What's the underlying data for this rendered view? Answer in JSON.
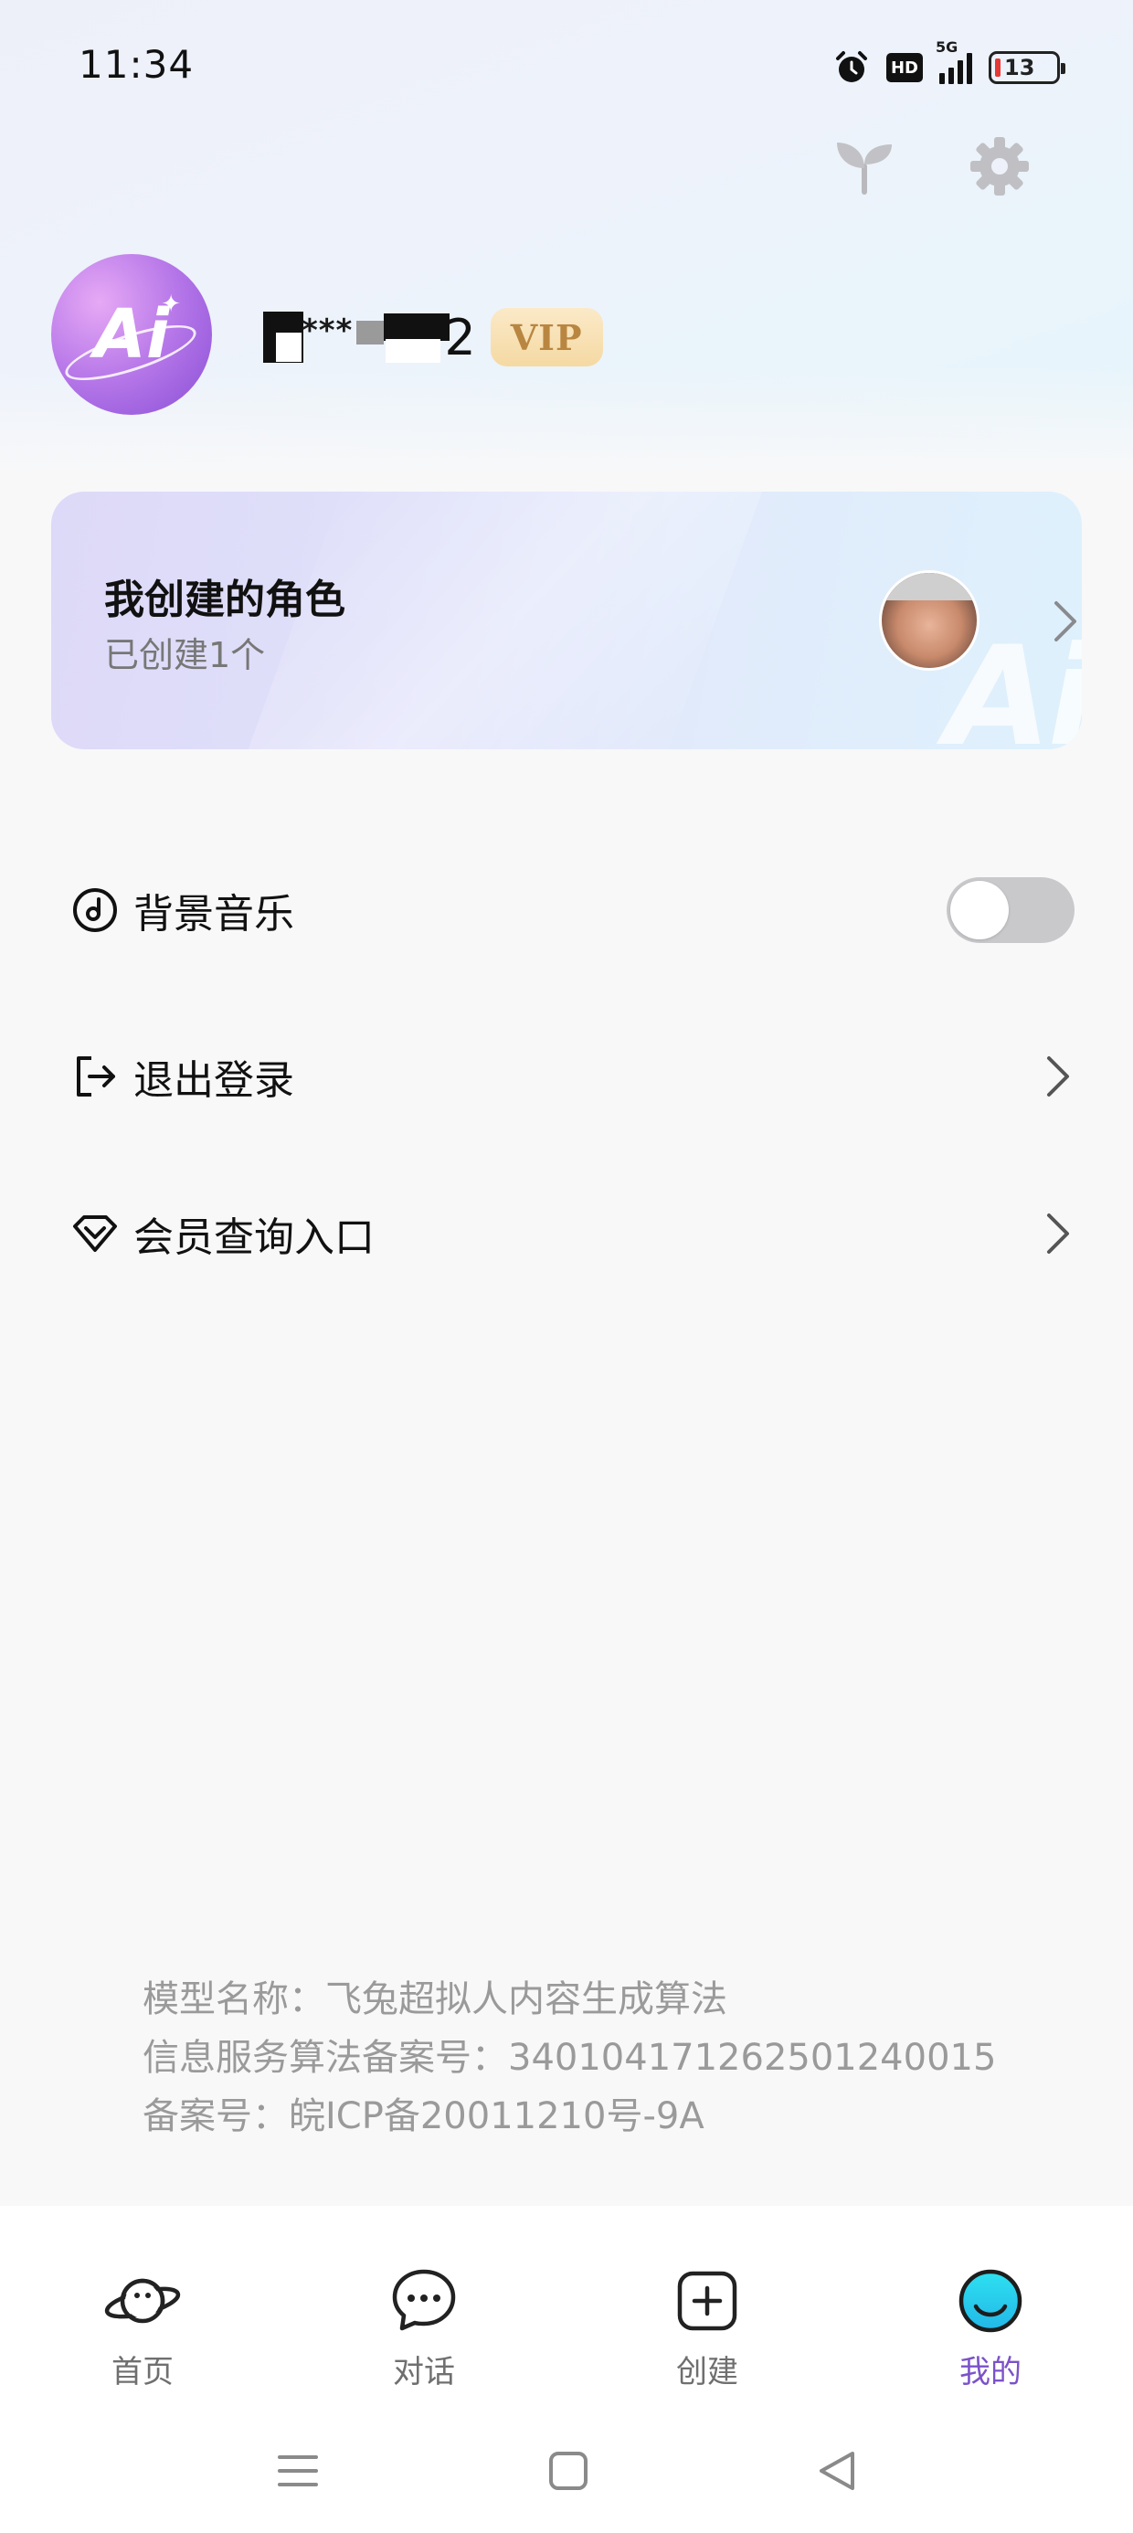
{
  "status_bar": {
    "time": "11:34",
    "hd_label": "HD",
    "network_label": "5G",
    "battery_level": "13"
  },
  "header": {
    "avatar_text": "Ai",
    "username": "2",
    "vip_label": "VIP"
  },
  "role_card": {
    "title": "我创建的角色",
    "subtitle": "已创建1个",
    "watermark": "Ai"
  },
  "menu": {
    "items": [
      {
        "label": "背景音乐",
        "icon": "music-disc-icon",
        "control": "toggle",
        "toggle_on": false
      },
      {
        "label": "退出登录",
        "icon": "logout-icon",
        "control": "chevron"
      },
      {
        "label": "会员查询入口",
        "icon": "diamond-icon",
        "control": "chevron"
      }
    ]
  },
  "footer_info": {
    "model_name": "模型名称：飞兔超拟人内容生成算法",
    "algorithm_record": "信息服务算法备案号：340104171262501240015",
    "icp_record": "备案号：皖ICP备20011210号-9A"
  },
  "tabs": [
    {
      "label": "首页",
      "icon": "planet-icon",
      "active": false
    },
    {
      "label": "对话",
      "icon": "chat-bubble-icon",
      "active": false
    },
    {
      "label": "创建",
      "icon": "add-square-icon",
      "active": false
    },
    {
      "label": "我的",
      "icon": "profile-face-icon",
      "active": true
    }
  ],
  "colors": {
    "accent": "#7b52c9",
    "vip_gold": "#b98641",
    "toggle_off": "#c9c9cc",
    "background": "#f8f8f9"
  }
}
